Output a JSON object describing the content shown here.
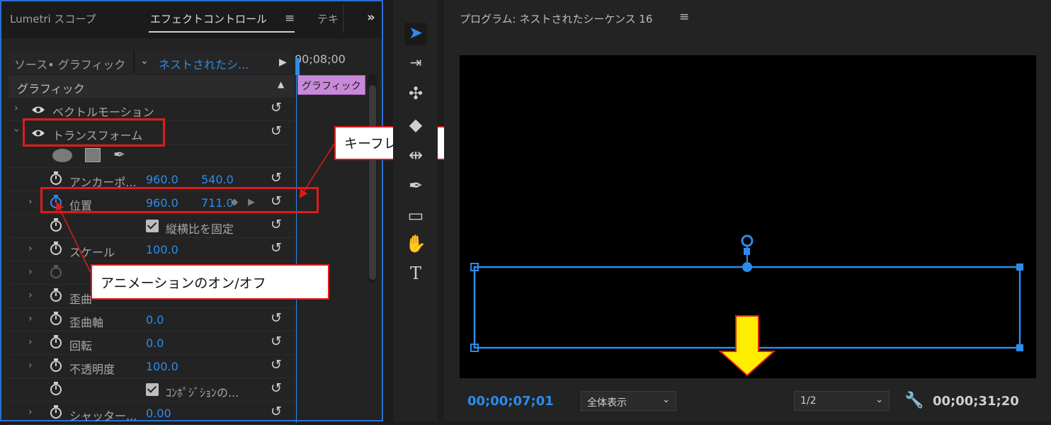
{
  "left_panel": {
    "tabs": [
      "Lumetri スコープ",
      "エフェクトコントロール",
      "テキ"
    ],
    "tab_menu_icon": "hamburger-icon",
    "overflow_icon": "double-chevron-right-icon",
    "source_label": "ソース• グラフィック",
    "source_value": "ネストされたシ...",
    "timeline_time": "00;08;00",
    "clip_label": "グラフィック",
    "section_title": "グラフィック",
    "rows": [
      {
        "label": "ベクトルモーション"
      },
      {
        "label": "トランスフォーム"
      },
      {
        "label": "アンカーポ..."
      },
      {
        "label": "位置"
      },
      {
        "label": "縦横比を固定"
      },
      {
        "label": "スケール"
      },
      {
        "label": "歪曲"
      },
      {
        "label": "歪曲軸"
      },
      {
        "label": "回転"
      },
      {
        "label": "不透明度"
      },
      {
        "label": "ｺﾝﾎﾟｼﾞｼｮﾝの..."
      },
      {
        "label": "シャッター..."
      }
    ],
    "values": {
      "anchor_x": "960.0",
      "anchor_y": "540.0",
      "position_x": "960.0",
      "position_y": "711.0",
      "scale": "100.0",
      "skew_axis": "0.0",
      "rotation": "0.0",
      "opacity": "100.0",
      "shutter": "0.00"
    }
  },
  "annotations": {
    "keyframe": "キーフレーム",
    "animation_toggle": "アニメーションのオン/オフ",
    "colors": {
      "box": "#e01b1b",
      "arrow_fill": "#ffee00",
      "arrow_stroke": "#e01b1b"
    }
  },
  "tools": [
    "selection-tool",
    "track-select-tool",
    "ripple-edit-tool",
    "razor-tool",
    "slip-tool",
    "pen-tool",
    "rectangle-tool",
    "hand-tool",
    "type-tool"
  ],
  "program": {
    "title": "プログラム: ネストされたシーケンス 16",
    "current_time": "00;00;07;01",
    "zoom": "全体表示",
    "resolution": "1/2",
    "duration": "00;00;31;20"
  },
  "theme": {
    "accent": "#2d8ceb",
    "panel_bg": "#232323"
  }
}
